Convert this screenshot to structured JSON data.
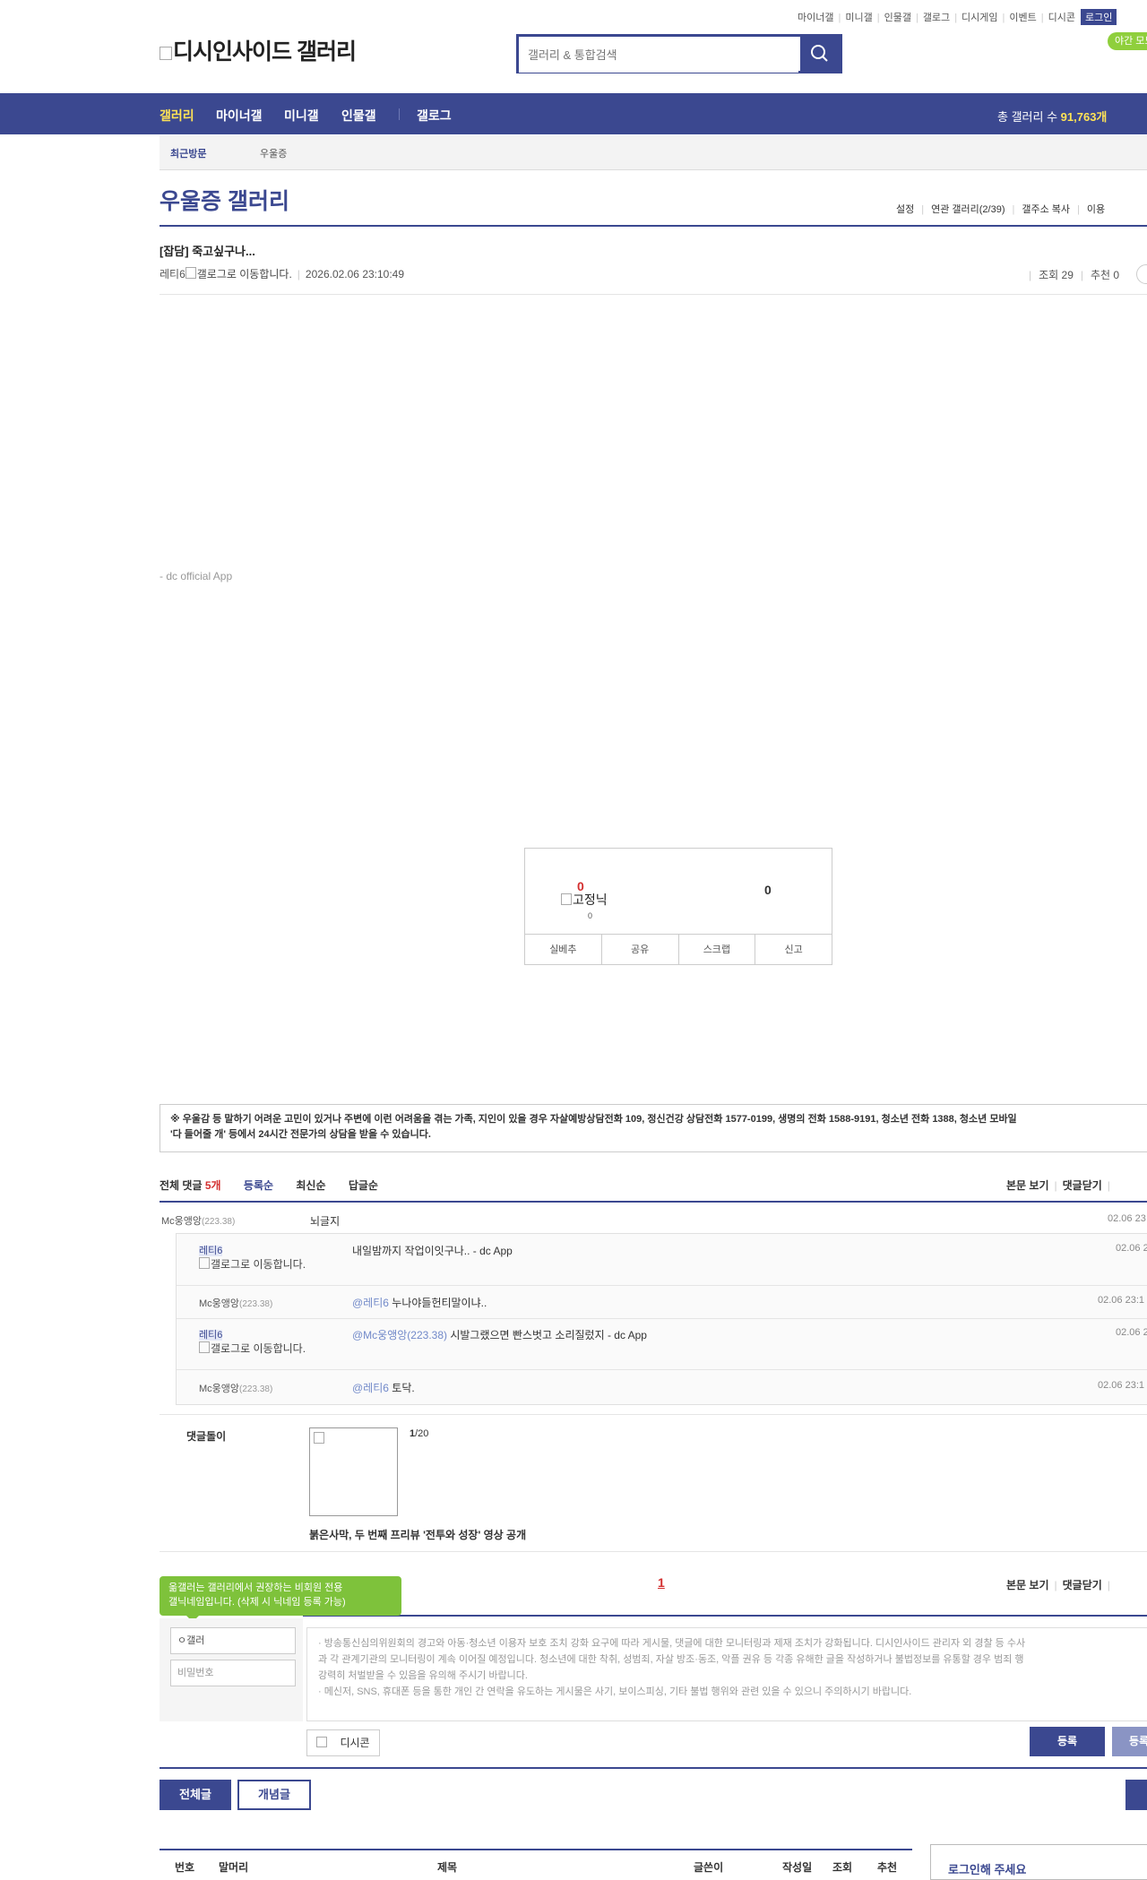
{
  "header": {
    "topnav": [
      "마이너갤",
      "미니갤",
      "인물갤",
      "갤로그",
      "디시게임",
      "이벤트",
      "디시콘"
    ],
    "login_label": "로그인",
    "night_label": "야간 모드",
    "logo_text": "디시인사이드 갤러리",
    "search_placeholder": "갤러리 & 통합검색"
  },
  "gnb": {
    "items": [
      "갤러리",
      "마이너갤",
      "미니갤",
      "인물갤",
      "갤로그"
    ],
    "total_label": "총 갤러리 수",
    "total_count": "91,763개"
  },
  "recent": {
    "label": "최근방문",
    "item": "우울증"
  },
  "gallery": {
    "title": "우울증 갤러리",
    "menu": [
      "설정",
      "연관 갤러리(2/39)",
      "갤주소 복사",
      "이용"
    ]
  },
  "post": {
    "title": "[잡담] 죽고싶구나...",
    "author": "레티6",
    "gallog_alt": "갤로그로 이동합니다.",
    "date": "2026.02.06 23:10:49",
    "views": "조회 29",
    "recommend": "추천 0",
    "footer": "- dc official App"
  },
  "recommend_box": {
    "up_count": "0",
    "fixed_label": "고정닉",
    "fixed_count": "0",
    "down_count": "0",
    "buttons": [
      "실베추",
      "공유",
      "스크랩",
      "신고"
    ]
  },
  "notice": {
    "line1": "※ 우울감 등 말하기 어려운 고민이 있거나 주변에 이런 어려움을 겪는 가족, 지인이 있을 경우 자살예방상담전화 109, 정신건강 상담전화 1577-0199, 생명의 전화 1588-9191, 청소년 전화 1388, 청소년 모바일",
    "line2": "'다 들어줄 개' 등에서 24시간 전문가의 상담을 받을 수 있습니다."
  },
  "comments": {
    "total_label": "전체 댓글",
    "total_count": "5개",
    "sorts": [
      "등록순",
      "최신순",
      "답글순"
    ],
    "controls": [
      "본문 보기",
      "댓글닫기"
    ],
    "items": [
      {
        "nick": "Mc웅앵앙",
        "ip": "(223.38)",
        "text": "뇌글지",
        "date": "02.06 23"
      },
      {
        "nick": "레티6",
        "gallog_alt": "갤로그로 이동합니다.",
        "text": "내일밤까지 작업이잇구나.. - dc App",
        "date": "02.06 2"
      },
      {
        "nick": "Mc웅앵앙",
        "ip": "(223.38)",
        "mention": "@레티6",
        "text": "누나야들헌티말이냐..",
        "date": "02.06 23:1"
      },
      {
        "nick": "레티6",
        "gallog_alt": "갤로그로 이동합니다.",
        "mention": "@Mc웅앵앙(223.38)",
        "text": "시발그랬으면 빤스벗고 소리질렀지 - dc App",
        "date": "02.06 2"
      },
      {
        "nick": "Mc웅앵앙",
        "ip": "(223.38)",
        "mention": "@레티6",
        "text": "토닥.",
        "date": "02.06 23:1"
      }
    ]
  },
  "dolgi": {
    "label": "댓글돌이",
    "page": "1",
    "page_total": "/20",
    "caption": "붉은사막, 두 번째 프리뷰 '전투와 성장' 영상 공개"
  },
  "pagination": {
    "current": "1"
  },
  "form": {
    "tooltip_line1": "옮갤러는 갤러리에서 권장하는 비회원 전용",
    "tooltip_line2": "갤닉네임입니다. (삭제 시 닉네임 등록 가능)",
    "nick_value": "ㅇ갤러",
    "password_placeholder": "비밀번호",
    "notice_lines": [
      "· 방송통신심의위원회의 경고와 아동·청소년 이용자 보호 조치 강화 요구에 따라 게시물, 댓글에 대한 모니터링과 제재 조치가 강화됩니다. 디시인사이드 관리자 외 경찰 등 수사",
      "과 각 관계기관의 모니터링이 계속 이어질 예정입니다. 청소년에 대한 착취, 성범죄, 자살 방조·동조, 악플 권유 등 각종 유해한 글을 작성하거나 불법정보를 유통할 경우 범죄 행",
      "강력히 처벌받을 수 있음을 유의해 주시기 바랍니다.",
      "· 메신저, SNS, 휴대폰 등을 통한 개인 간 연락을 유도하는 게시물은 사기, 보이스피싱, 기타 불법 행위와 관련 있을 수 있으니 주의하시기 바랍니다."
    ],
    "dccon_label": "디시콘",
    "submit_label": "등록",
    "submit2_label": "등록"
  },
  "list_buttons": {
    "all": "전체글",
    "concept": "개념글"
  },
  "list_header": [
    "번호",
    "말머리",
    "제목",
    "글쓴이",
    "작성일",
    "조회",
    "추천"
  ],
  "login_prompt": "로그인해 주세요"
}
